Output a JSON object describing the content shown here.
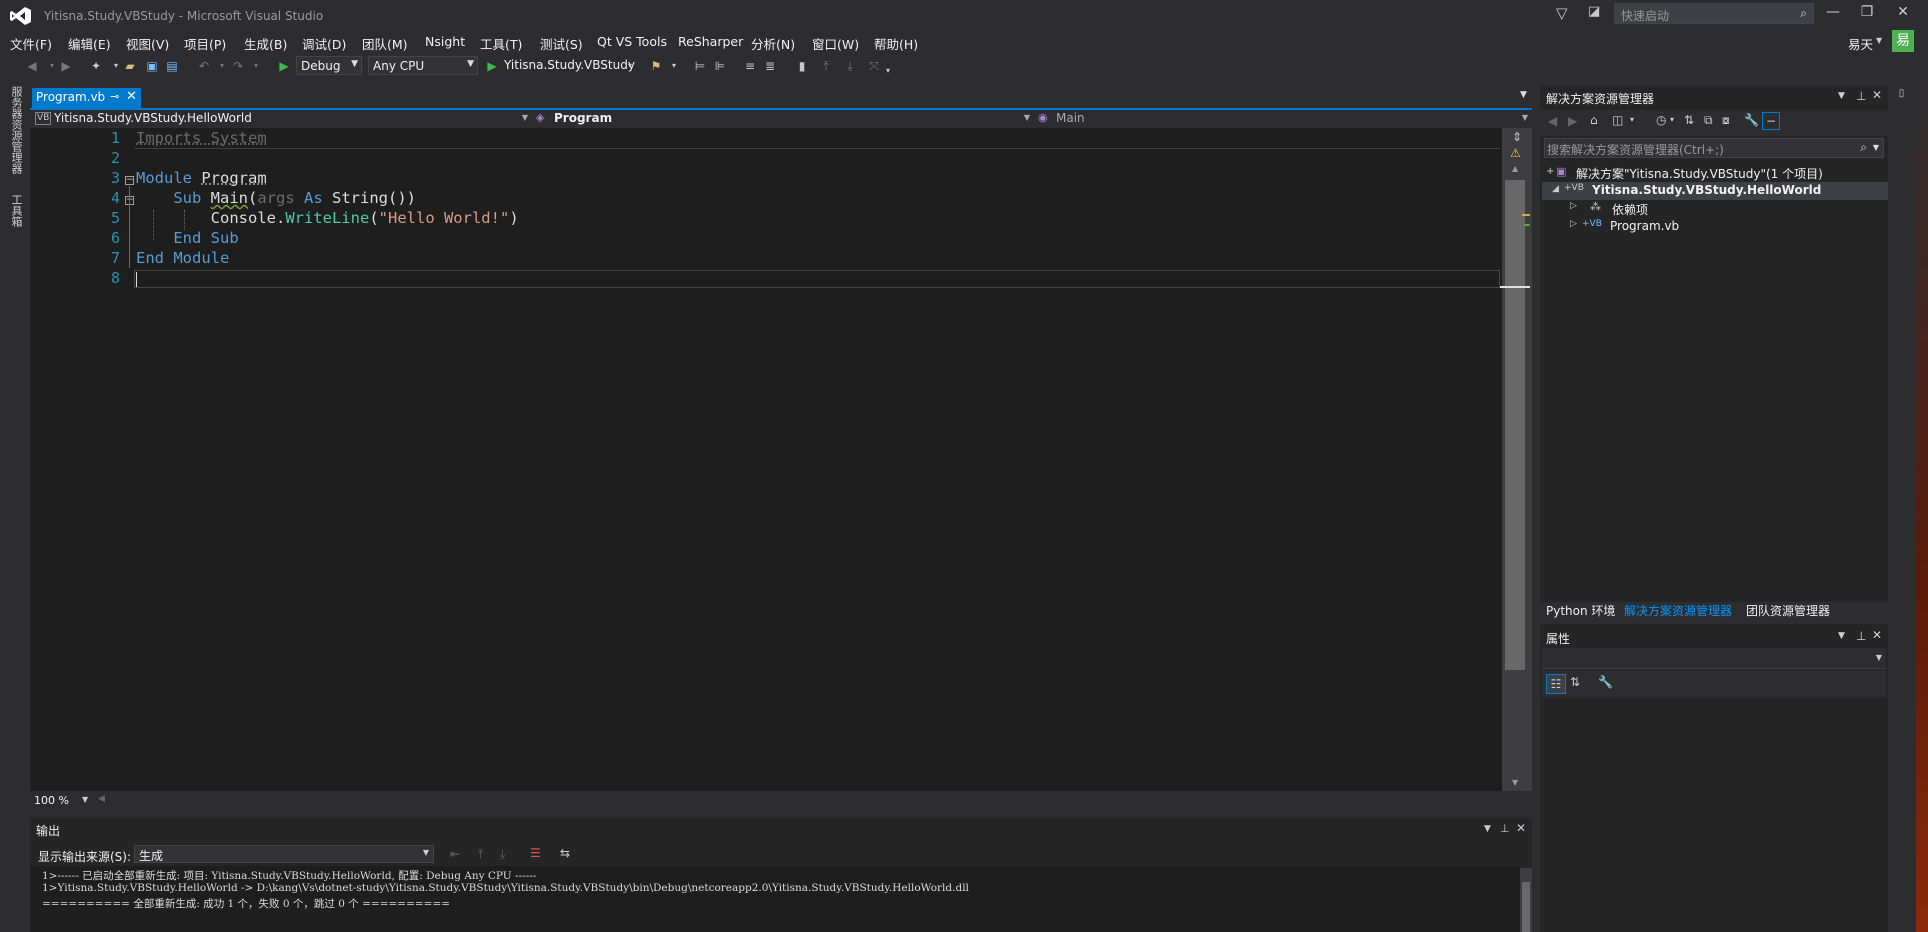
{
  "window": {
    "title": "Yitisna.Study.VBStudy - Microsoft Visual Studio",
    "quick_launch_placeholder": "快速启动",
    "user_name": "易天",
    "user_avatar_char": "易"
  },
  "menu": [
    "文件(F)",
    "编辑(E)",
    "视图(V)",
    "项目(P)",
    "生成(B)",
    "调试(D)",
    "团队(M)",
    "Nsight",
    "工具(T)",
    "测试(S)",
    "Qt VS Tools",
    "ReSharper",
    "分析(N)",
    "窗口(W)",
    "帮助(H)"
  ],
  "toolbar": {
    "config": "Debug",
    "platform": "Any CPU",
    "start_target": "Yitisna.Study.VBStudy"
  },
  "left_strip": [
    "服务器资源管理器",
    "工具箱"
  ],
  "document": {
    "tab_label": "Program.vb",
    "nav_project": "Yitisna.Study.VBStudy.HelloWorld",
    "nav_class": "Program",
    "nav_member": "Main",
    "zoom": "100 %"
  },
  "code": {
    "line_numbers": [
      "1",
      "2",
      "3",
      "4",
      "5",
      "6",
      "7",
      "8"
    ]
  },
  "output": {
    "title": "输出",
    "source_label": "显示输出来源(S):",
    "source_value": "生成",
    "lines": [
      "1>------ 已启动全部重新生成: 项目: Yitisna.Study.VBStudy.HelloWorld, 配置: Debug Any CPU ------",
      "1>Yitisna.Study.VBStudy.HelloWorld -> D:\\kang\\Vs\\dotnet-study\\Yitisna.Study.VBStudy\\Yitisna.Study.VBStudy\\bin\\Debug\\netcoreapp2.0\\Yitisna.Study.VBStudy.HelloWorld.dll",
      "========== 全部重新生成: 成功 1 个，失败 0 个，跳过 0 个 =========="
    ]
  },
  "solution_explorer": {
    "title": "解决方案资源管理器",
    "search_placeholder": "搜索解决方案资源管理器(Ctrl+;)",
    "solution_node": "解决方案\"Yitisna.Study.VBStudy\"(1 个项目)",
    "project_node": "Yitisna.Study.VBStudy.HelloWorld",
    "deps_node": "依赖项",
    "file_node": "Program.vb",
    "tabs": [
      "Python 环境",
      "解决方案资源管理器",
      "团队资源管理器"
    ]
  },
  "properties": {
    "title": "属性"
  },
  "colors": {
    "accent": "#007acc",
    "keyword": "#569cd6",
    "string": "#d69d85",
    "background": "#1e1e1e"
  }
}
